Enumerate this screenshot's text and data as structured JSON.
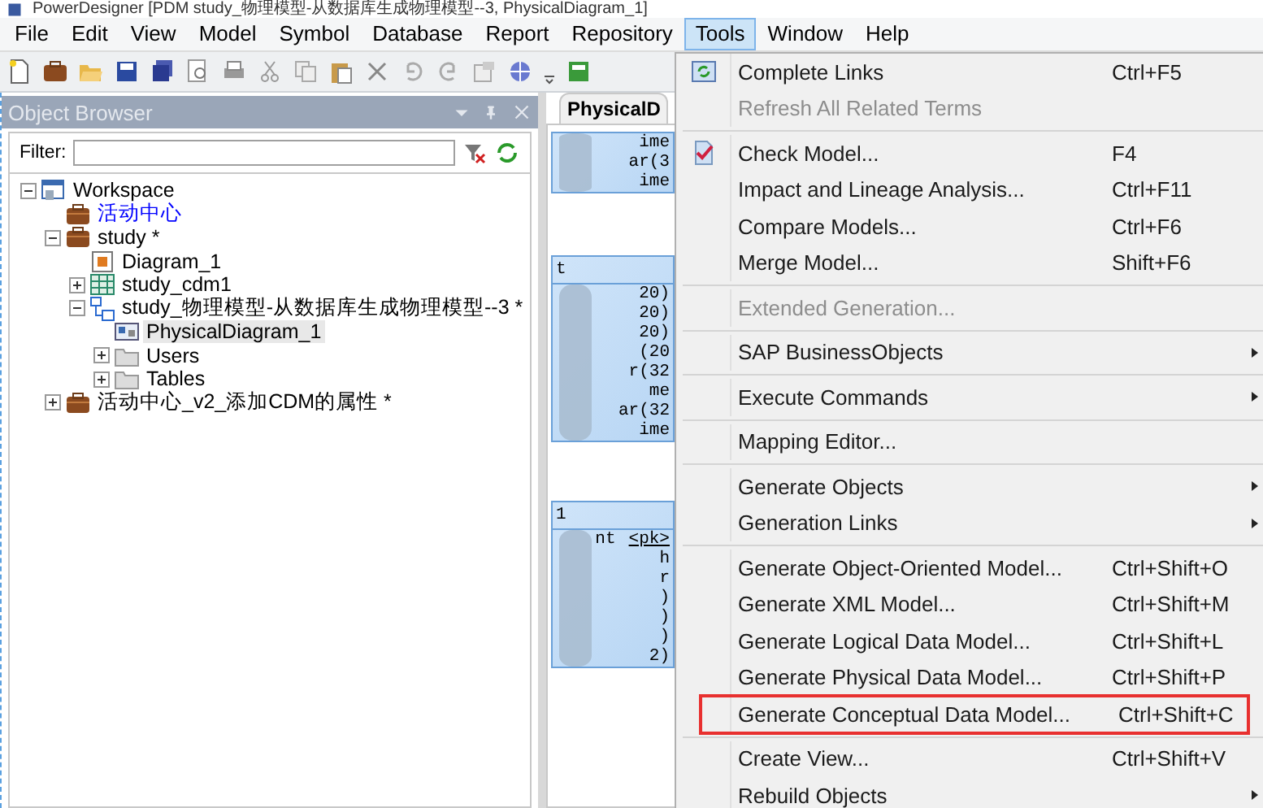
{
  "window": {
    "title": "PowerDesigner [PDM study_物理模型-从数据库生成物理模型--3, PhysicalDiagram_1]"
  },
  "menubar": [
    {
      "label": "File",
      "selected": false
    },
    {
      "label": "Edit",
      "selected": false
    },
    {
      "label": "View",
      "selected": false
    },
    {
      "label": "Model",
      "selected": false
    },
    {
      "label": "Symbol",
      "selected": false
    },
    {
      "label": "Database",
      "selected": false
    },
    {
      "label": "Report",
      "selected": false
    },
    {
      "label": "Repository",
      "selected": false
    },
    {
      "label": "Tools",
      "selected": true
    },
    {
      "label": "Window",
      "selected": false
    },
    {
      "label": "Help",
      "selected": false
    }
  ],
  "object_browser": {
    "title": "Object Browser",
    "filter_label": "Filter:",
    "tree": [
      {
        "label": "Workspace",
        "kind": "workspace",
        "color": "#000000",
        "selected": false,
        "expanded": true,
        "children": [
          {
            "label": "活动中心",
            "kind": "model",
            "color": "#0000ff",
            "selected": false
          },
          {
            "label": "study *",
            "kind": "model",
            "color": "#000000",
            "selected": false,
            "expanded": true,
            "children": [
              {
                "label": "Diagram_1",
                "kind": "diagram",
                "color": "#000000",
                "selected": false
              },
              {
                "label": "study_cdm1",
                "kind": "cdm",
                "color": "#000000",
                "selected": false,
                "expanded": false
              },
              {
                "label": "study_物理模型-从数据库生成物理模型--3 *",
                "kind": "pdm",
                "color": "#000000",
                "selected": false,
                "expanded": true,
                "children": [
                  {
                    "label": "PhysicalDiagram_1",
                    "kind": "physical-diagram",
                    "color": "#000000",
                    "selected": true
                  },
                  {
                    "label": "Users",
                    "kind": "folder",
                    "color": "#000000",
                    "selected": false,
                    "expanded": false
                  },
                  {
                    "label": "Tables",
                    "kind": "folder",
                    "color": "#000000",
                    "selected": false,
                    "expanded": false
                  }
                ]
              }
            ]
          },
          {
            "label": "活动中心_v2_添加CDM的属性 *",
            "kind": "model",
            "color": "#000000",
            "selected": false,
            "expanded": false
          }
        ]
      }
    ]
  },
  "diagram": {
    "tab": "PhysicalD",
    "tables": [
      {
        "rows": [
          {
            "text": "ime"
          },
          {
            "text": "ar(3"
          },
          {
            "text": "ime"
          }
        ]
      },
      {
        "header": "t",
        "rows": [
          {
            "text": "20)"
          },
          {
            "text": "20)"
          },
          {
            "text": "20)"
          },
          {
            "text": "(20"
          },
          {
            "text": "r(32"
          },
          {
            "text": "me"
          },
          {
            "text": "ar(32"
          },
          {
            "text": "ime"
          }
        ]
      },
      {
        "header": "1",
        "rows": [
          {
            "text": "nt",
            "tag": "<pk>"
          },
          {
            "text": "h"
          },
          {
            "text": "r"
          },
          {
            "text": ")"
          },
          {
            "text": ")"
          },
          {
            "text": ")"
          },
          {
            "text": "2)"
          }
        ]
      }
    ]
  },
  "tools_menu": {
    "groups": [
      [
        {
          "label": "Complete Links",
          "shortcut": "Ctrl+F5",
          "disabled": false,
          "submenu": false,
          "boxed": false
        },
        {
          "label": "Refresh All Related Terms",
          "disabled": true,
          "submenu": false,
          "boxed": false
        }
      ],
      [
        {
          "label": "Check Model...",
          "shortcut": "F4",
          "disabled": false,
          "submenu": false,
          "boxed": false
        },
        {
          "label": "Impact and Lineage Analysis...",
          "shortcut": "Ctrl+F11",
          "disabled": false,
          "submenu": false,
          "boxed": false
        },
        {
          "label": "Compare Models...",
          "shortcut": "Ctrl+F6",
          "disabled": false,
          "submenu": false,
          "boxed": false
        },
        {
          "label": "Merge Model...",
          "shortcut": "Shift+F6",
          "disabled": false,
          "submenu": false,
          "boxed": false
        }
      ],
      [
        {
          "label": "Extended Generation...",
          "disabled": true,
          "submenu": false,
          "boxed": false
        }
      ],
      [
        {
          "label": "SAP BusinessObjects",
          "disabled": false,
          "submenu": true,
          "boxed": false
        }
      ],
      [
        {
          "label": "Execute Commands",
          "disabled": false,
          "submenu": true,
          "boxed": false
        }
      ],
      [
        {
          "label": "Mapping Editor...",
          "disabled": false,
          "submenu": false,
          "boxed": false
        }
      ],
      [
        {
          "label": "Generate Objects",
          "disabled": false,
          "submenu": true,
          "boxed": false
        },
        {
          "label": "Generation Links",
          "disabled": false,
          "submenu": true,
          "boxed": false
        }
      ],
      [
        {
          "label": "Generate Object-Oriented Model...",
          "shortcut": "Ctrl+Shift+O",
          "disabled": false,
          "submenu": false,
          "boxed": false
        },
        {
          "label": "Generate XML Model...",
          "shortcut": "Ctrl+Shift+M",
          "disabled": false,
          "submenu": false,
          "boxed": false
        },
        {
          "label": "Generate Logical Data Model...",
          "shortcut": "Ctrl+Shift+L",
          "disabled": false,
          "submenu": false,
          "boxed": false
        },
        {
          "label": "Generate Physical Data Model...",
          "shortcut": "Ctrl+Shift+P",
          "disabled": false,
          "submenu": false,
          "boxed": false
        },
        {
          "label": "Generate Conceptual Data Model...",
          "shortcut": "Ctrl+Shift+C",
          "disabled": false,
          "submenu": false,
          "boxed": true
        }
      ],
      [
        {
          "label": "Create View...",
          "shortcut": "Ctrl+Shift+V",
          "disabled": false,
          "submenu": false,
          "boxed": false
        },
        {
          "label": "Rebuild Objects",
          "disabled": false,
          "submenu": true,
          "boxed": false
        }
      ]
    ]
  }
}
